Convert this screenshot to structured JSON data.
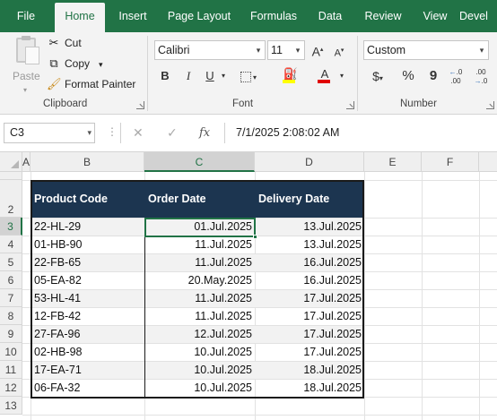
{
  "tabs": [
    "File",
    "Home",
    "Insert",
    "Page Layout",
    "Formulas",
    "Data",
    "Review",
    "View",
    "Devel"
  ],
  "ribbon": {
    "clipboard": {
      "paste": "Paste",
      "cut": "Cut",
      "copy": "Copy",
      "format_painter": "Format Painter",
      "label": "Clipboard"
    },
    "font": {
      "name": "Calibri",
      "size": "11",
      "bold": "B",
      "italic": "I",
      "underline": "U",
      "grow": "A",
      "shrink": "A",
      "font_color_letter": "A",
      "label": "Font"
    },
    "number": {
      "format": "Custom",
      "currency": "$",
      "percent": "%",
      "comma": "9",
      "label": "Number"
    }
  },
  "formula_bar": {
    "name_box": "C3",
    "fx": "fx",
    "content": "7/1/2025  2:08:02 AM"
  },
  "columns": [
    "A",
    "B",
    "C",
    "D",
    "E",
    "F"
  ],
  "rows": [
    "1",
    "2",
    "3",
    "4",
    "5",
    "6",
    "7",
    "8",
    "9",
    "10",
    "11",
    "12",
    "13"
  ],
  "table": {
    "headers": [
      "Product Code",
      "Order Date",
      "Delivery Date"
    ],
    "rows": [
      [
        "22-HL-29",
        "01.Jul.2025",
        "13.Jul.2025"
      ],
      [
        "01-HB-90",
        "11.Jul.2025",
        "13.Jul.2025"
      ],
      [
        "22-FB-65",
        "11.Jul.2025",
        "16.Jul.2025"
      ],
      [
        "05-EA-82",
        "20.May.2025",
        "16.Jul.2025"
      ],
      [
        "53-HL-41",
        "11.Jul.2025",
        "17.Jul.2025"
      ],
      [
        "12-FB-42",
        "11.Jul.2025",
        "17.Jul.2025"
      ],
      [
        "27-FA-96",
        "12.Jul.2025",
        "17.Jul.2025"
      ],
      [
        "02-HB-98",
        "10.Jul.2025",
        "17.Jul.2025"
      ],
      [
        "17-EA-71",
        "10.Jul.2025",
        "18.Jul.2025"
      ],
      [
        "06-FA-32",
        "10.Jul.2025",
        "18.Jul.2025"
      ]
    ]
  },
  "colors": {
    "excel_green": "#217346",
    "table_header": "#1c3550",
    "band": "#f2f2f2"
  }
}
